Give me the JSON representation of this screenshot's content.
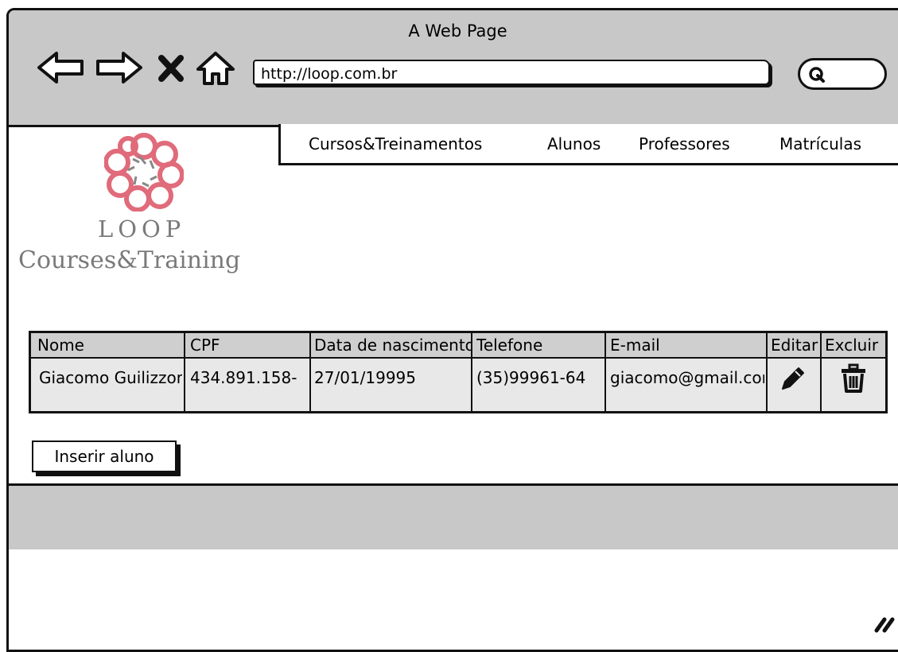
{
  "window": {
    "title": "A Web Page"
  },
  "toolbar": {
    "back_icon": "arrow-left-icon",
    "forward_icon": "arrow-right-icon",
    "stop_icon": "close-icon",
    "home_icon": "home-icon",
    "url": "http://loop.com.br",
    "search_icon": "search-icon"
  },
  "menu": {
    "items": [
      {
        "label": "Cursos&Treinamentos"
      },
      {
        "label": "Alunos"
      },
      {
        "label": "Professores"
      },
      {
        "label": "Matrículas"
      }
    ]
  },
  "logo": {
    "line1": "LOOP",
    "line2": "Courses&Training",
    "brand_color": "#e06b7a"
  },
  "table": {
    "headers": [
      "Nome",
      "CPF",
      "Data de nascimento",
      "Telefone",
      "E-mail",
      "Editar",
      "Excluir"
    ],
    "rows": [
      {
        "nome": "Giacomo Guilizzoni",
        "cpf": "434.891.158-",
        "nascimento": "27/01/19995",
        "telefone": "(35)99961-64",
        "email": "giacomo@gmail.com",
        "edit_icon": "pencil-icon",
        "delete_icon": "trash-icon"
      }
    ]
  },
  "actions": {
    "insert_label": "Inserir aluno"
  },
  "status_bar": {
    "resize_icon": "resize-grip-icon"
  }
}
